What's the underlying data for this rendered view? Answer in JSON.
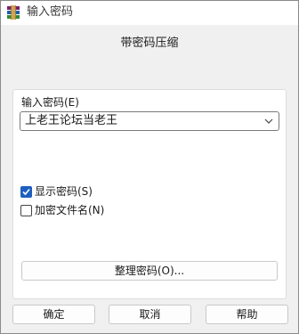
{
  "window": {
    "title": "输入密码",
    "app_icon": "winrar-icon"
  },
  "dialog": {
    "heading": "带密码压缩",
    "password_label": "输入密码(E)",
    "password_value": "上老王论坛当老王",
    "dropdown_icon": "chevron-down-icon",
    "show_password": {
      "label": "显示密码(S)",
      "checked": true
    },
    "encrypt_filenames": {
      "label": "加密文件名(N)",
      "checked": false
    },
    "manage_button": "整理密码(O)..."
  },
  "buttons": {
    "ok": "确定",
    "cancel": "取消",
    "help": "帮助"
  },
  "colors": {
    "accent": "#1d5fbf",
    "titlebar": "#ffffff",
    "background": "#f0f0f0"
  }
}
